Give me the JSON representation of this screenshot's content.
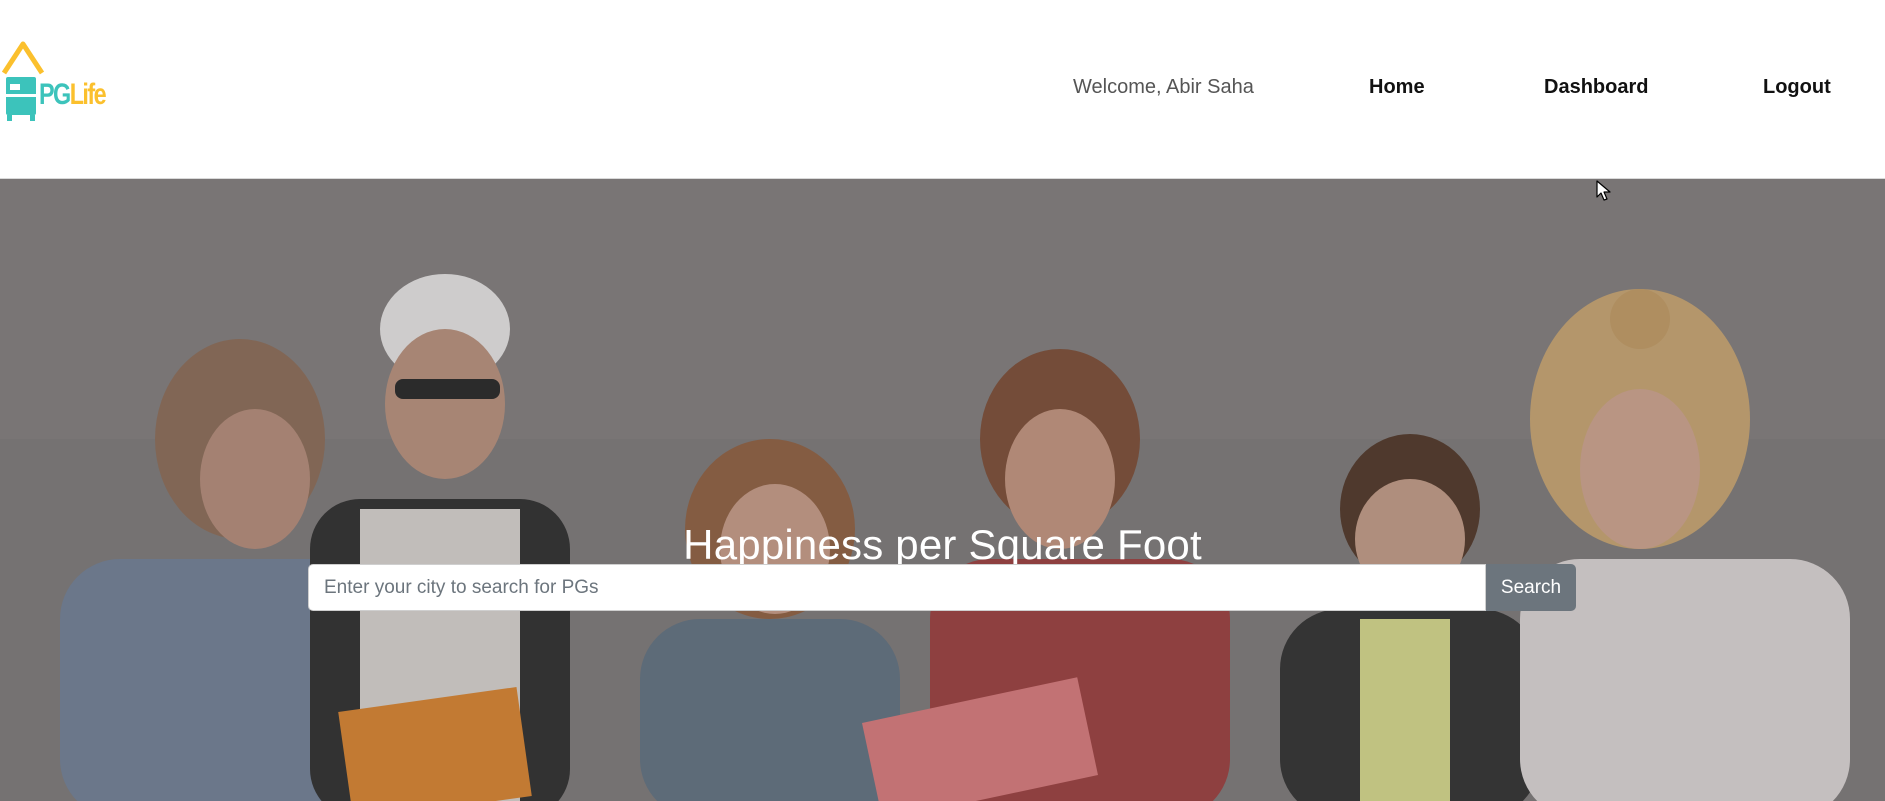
{
  "brand": {
    "logo_pg": "PG",
    "logo_life": "Life",
    "colors": {
      "teal": "#3cc3bb",
      "yellow": "#fbc02d"
    }
  },
  "nav": {
    "welcome": "Welcome, Abir Saha",
    "home": "Home",
    "dashboard": "Dashboard",
    "logout": "Logout"
  },
  "hero": {
    "title": "Happiness per Square Foot",
    "search_placeholder": "Enter your city to search for PGs",
    "search_value": "",
    "search_button": "Search",
    "background": "group-of-students-reading-photo"
  },
  "icons": {
    "logo": "house-bed-logo-icon",
    "cursor": "mouse-pointer-icon"
  }
}
